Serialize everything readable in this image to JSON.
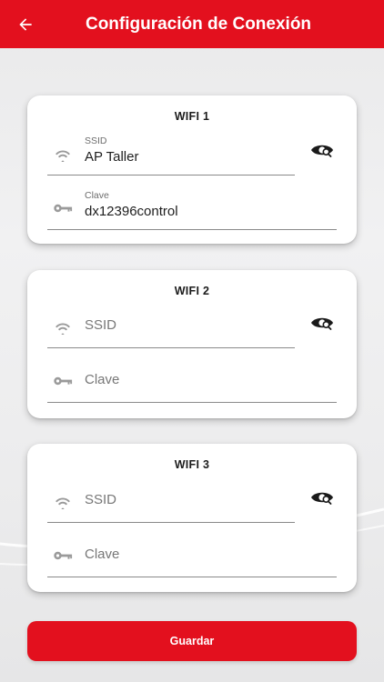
{
  "header": {
    "title": "Configuración de Conexión",
    "back_icon": "arrow-left-icon",
    "background": "#e3101e"
  },
  "wifi_cards": [
    {
      "title": "WIFI 1",
      "ssid": {
        "label": "SSID",
        "value": "AP Taller",
        "placeholder": "SSID",
        "icon": "wifi-icon"
      },
      "password": {
        "label": "Clave",
        "value": "dx12396control",
        "placeholder": "Clave",
        "icon": "key-icon"
      },
      "visibility_icon": "eye-icon"
    },
    {
      "title": "WIFI 2",
      "ssid": {
        "label": "",
        "value": "",
        "placeholder": "SSID",
        "icon": "wifi-icon"
      },
      "password": {
        "label": "",
        "value": "",
        "placeholder": "Clave",
        "icon": "key-icon"
      },
      "visibility_icon": "eye-icon"
    },
    {
      "title": "WIFI 3",
      "ssid": {
        "label": "",
        "value": "",
        "placeholder": "SSID",
        "icon": "wifi-icon"
      },
      "password": {
        "label": "",
        "value": "",
        "placeholder": "Clave",
        "icon": "key-icon"
      },
      "visibility_icon": "eye-icon"
    }
  ],
  "save_button": {
    "label": "Guardar",
    "color": "#e3101e"
  }
}
